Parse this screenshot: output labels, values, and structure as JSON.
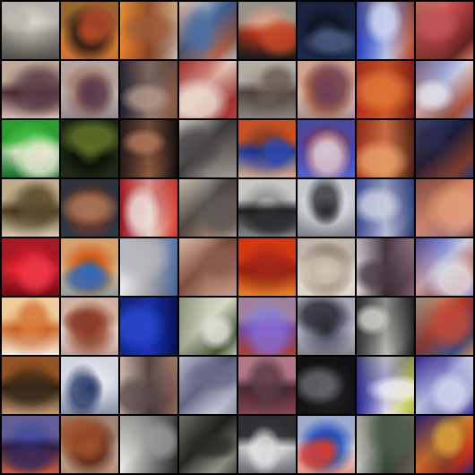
{
  "grid": {
    "rows": 8,
    "cols": 8,
    "background": "#000000",
    "tiles": [
      {
        "c": [
          "#f3f1ea",
          "#b8b4aa",
          "#6b6a66"
        ]
      },
      {
        "c": [
          "#e9a44a",
          "#b54a2a",
          "#3b2a24"
        ]
      },
      {
        "c": [
          "#f19b3a",
          "#9a5b3a",
          "#d9d2c9"
        ]
      },
      {
        "c": [
          "#f2f0ea",
          "#4d6fa0",
          "#c96b4a"
        ]
      },
      {
        "c": [
          "#f1e7d6",
          "#c74a2a",
          "#2a2a2e"
        ]
      },
      {
        "c": [
          "#2a3a64",
          "#4d5e86",
          "#1a2238"
        ]
      },
      {
        "c": [
          "#3a5ad0",
          "#d4dcf2",
          "#c85a3a"
        ]
      },
      {
        "c": [
          "#f3a18a",
          "#c0555a",
          "#6b2e2e"
        ]
      },
      {
        "c": [
          "#c9b7a8",
          "#5a3a44",
          "#e2d2c6"
        ]
      },
      {
        "c": [
          "#d3d0cc",
          "#5a3a4c",
          "#b08a7e"
        ]
      },
      {
        "c": [
          "#2e3044",
          "#b59a8a",
          "#9c6a52"
        ]
      },
      {
        "c": [
          "#c0443e",
          "#f0e3d8",
          "#a2383a"
        ]
      },
      {
        "c": [
          "#d6d2c8",
          "#6a5a52",
          "#a2a09a"
        ]
      },
      {
        "c": [
          "#e9d6d0",
          "#6a4056",
          "#c87a4a"
        ]
      },
      {
        "c": [
          "#c9442a",
          "#e07a38",
          "#8a2a22"
        ]
      },
      {
        "c": [
          "#7a8ad0",
          "#e6e6ee",
          "#c05a3a"
        ]
      },
      {
        "c": [
          "#4ac84a",
          "#e9e9d2",
          "#1a8a3a"
        ]
      },
      {
        "c": [
          "#2a3a1e",
          "#6a7a2a",
          "#121810"
        ]
      },
      {
        "c": [
          "#3a2a22",
          "#b07a5a",
          "#1a1416"
        ]
      },
      {
        "c": [
          "#e4e2da",
          "#4a4648",
          "#a6a29a"
        ]
      },
      {
        "c": [
          "#d05a2a",
          "#2a48b0",
          "#e9c2a2"
        ]
      },
      {
        "c": [
          "#5a6ad8",
          "#e2d2dc",
          "#9a4a6a"
        ]
      },
      {
        "c": [
          "#c2442a",
          "#e8a26a",
          "#5a2a22"
        ]
      },
      {
        "c": [
          "#4a5a9a",
          "#2a2a4a",
          "#c05a3a"
        ]
      },
      {
        "c": [
          "#c8b89a",
          "#5a4a2a",
          "#e6dcc8"
        ]
      },
      {
        "c": [
          "#3a4a5a",
          "#b07a5a",
          "#8a4a3a"
        ]
      },
      {
        "c": [
          "#b0202a",
          "#f0e6e0",
          "#e04a3a"
        ]
      },
      {
        "c": [
          "#e8e4dc",
          "#5a5654",
          "#b08a7a"
        ]
      },
      {
        "c": [
          "#f0eeea",
          "#2a2a2e",
          "#a2a2a2"
        ]
      },
      {
        "c": [
          "#c8ccd2",
          "#2a2c32",
          "#f2f2f4"
        ]
      },
      {
        "c": [
          "#5a6ab0",
          "#d2d6e2",
          "#3a4e88"
        ]
      },
      {
        "c": [
          "#8a5a4a",
          "#e6a07a",
          "#c8a2c2"
        ]
      },
      {
        "c": [
          "#d02a3a",
          "#f03a4a",
          "#8a1020"
        ]
      },
      {
        "c": [
          "#e2d2b0",
          "#2a6ac2",
          "#e07a2a"
        ]
      },
      {
        "c": [
          "#f2f2f2",
          "#b6b6ba",
          "#5a7ab0"
        ]
      },
      {
        "c": [
          "#f0dcd0",
          "#8a5a4a",
          "#c8a08a"
        ]
      },
      {
        "c": [
          "#d8441a",
          "#a2281a",
          "#f0a23a"
        ]
      },
      {
        "c": [
          "#f2eee6",
          "#d2c8b8",
          "#8a7a6a"
        ]
      },
      {
        "c": [
          "#e6e6e8",
          "#4a3a44",
          "#9a7a8a"
        ]
      },
      {
        "c": [
          "#5a6ad8",
          "#e8e6ea",
          "#b04a3a"
        ]
      },
      {
        "c": [
          "#f2d2a0",
          "#d87a3a",
          "#f6f2ea"
        ]
      },
      {
        "c": [
          "#f2f0ee",
          "#8a3a2a",
          "#b06a4a"
        ]
      },
      {
        "c": [
          "#1a3aa2",
          "#2a4ad0",
          "#0a1a5a"
        ]
      },
      {
        "c": [
          "#c8ccb8",
          "#e6e6da",
          "#4a5a3a"
        ]
      },
      {
        "c": [
          "#b2b6e2",
          "#8a6ad0",
          "#c05a4a"
        ]
      },
      {
        "c": [
          "#d0d0da",
          "#2a2a34",
          "#8a8aa2"
        ]
      },
      {
        "c": [
          "#4a4a4e",
          "#d6d4ce",
          "#2a2a2e"
        ]
      },
      {
        "c": [
          "#e0c89a",
          "#c04a3a",
          "#3a5aa2"
        ]
      },
      {
        "c": [
          "#a2602a",
          "#3a2a1a",
          "#d6b08a"
        ]
      },
      {
        "c": [
          "#d8dce6",
          "#2a3a6a",
          "#f0f0f4"
        ]
      },
      {
        "c": [
          "#e6dcd0",
          "#5a4a4a",
          "#b0887a"
        ]
      },
      {
        "c": [
          "#c2c4d4",
          "#6a6a8a",
          "#e6e6ee"
        ]
      },
      {
        "c": [
          "#d6a4b4",
          "#5a3a44",
          "#a0606e"
        ]
      },
      {
        "c": [
          "#1a1a1e",
          "#6a6a6e",
          "#2e2e32"
        ]
      },
      {
        "c": [
          "#3a3ab0",
          "#f0f0f2",
          "#c8d04a"
        ]
      },
      {
        "c": [
          "#3a2aa2",
          "#d8dcf2",
          "#b6bcd8"
        ]
      },
      {
        "c": [
          "#6a7ad8",
          "#3a2a5a",
          "#d87a5a"
        ]
      },
      {
        "c": [
          "#d8c8b8",
          "#a2502a",
          "#6a3a2a"
        ]
      },
      {
        "c": [
          "#f4f2ee",
          "#9a9a9a",
          "#3a3a3a"
        ]
      },
      {
        "c": [
          "#7a7a72",
          "#2a2a26",
          "#c8c8be"
        ]
      },
      {
        "c": [
          "#3a3a3e",
          "#e6e6e8",
          "#8a8a8e"
        ]
      },
      {
        "c": [
          "#f0e8e0",
          "#d83a2a",
          "#3a6ad0"
        ]
      },
      {
        "c": [
          "#d6d6d2",
          "#4a5a4a",
          "#8a7a6a"
        ]
      },
      {
        "c": [
          "#2a2aa2",
          "#e0a23a",
          "#d83a2a"
        ]
      }
    ]
  }
}
